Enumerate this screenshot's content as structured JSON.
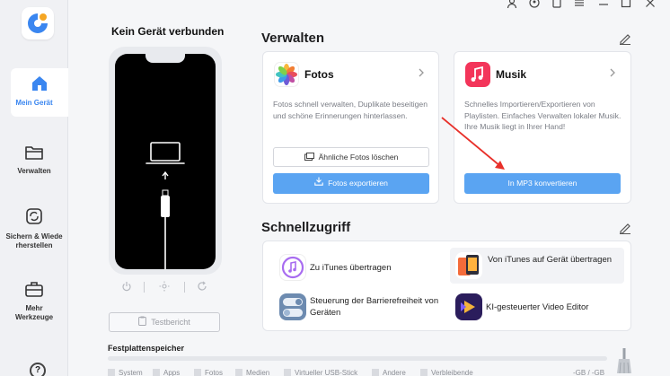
{
  "sidebar": {
    "items": [
      {
        "label": "Mein Gerät",
        "icon": "home-icon"
      },
      {
        "label": "Verwalten",
        "icon": "folder-icon"
      },
      {
        "label": "Sichern & Wiederherstellen",
        "icon": "backup-restore-icon"
      },
      {
        "label": "Mehr Werkzeuge",
        "icon": "toolbox-icon"
      }
    ],
    "help": "?"
  },
  "device": {
    "title": "Kein Gerät verbunden",
    "report_button": "Testbericht"
  },
  "manage": {
    "title": "Verwalten",
    "photos": {
      "title": "Fotos",
      "description": "Fotos schnell verwalten, Duplikate beseitigen und schöne Erinnerungen hinterlassen.",
      "button_secondary": "Ähnliche Fotos löschen",
      "button_primary": "Fotos exportieren"
    },
    "music": {
      "title": "Musik",
      "description": "Schnelles Importieren/Exportieren von Playlisten. Einfaches Verwalten lokaler Musik. Ihre Musik liegt in Ihrer Hand!",
      "button_primary": "In MP3 konvertieren"
    }
  },
  "quick": {
    "title": "Schnellzugriff",
    "items": [
      {
        "label": "Zu iTunes übertragen"
      },
      {
        "label": "Von iTunes auf Gerät übertragen"
      },
      {
        "label": "Steuerung der Barrierefreiheit von Geräten"
      },
      {
        "label": "KI-gesteuerter Video Editor"
      }
    ]
  },
  "storage": {
    "title": "Festplattenspeicher",
    "legend": [
      "System",
      "Apps",
      "Fotos",
      "Medien",
      "Virtueller USB-Stick",
      "Andere",
      "Verbleibende"
    ],
    "capacity": "-GB / -GB"
  },
  "colors": {
    "accent": "#3a86f0",
    "button_blue": "#5aa4f2",
    "annotation_arrow": "#e8302a"
  }
}
